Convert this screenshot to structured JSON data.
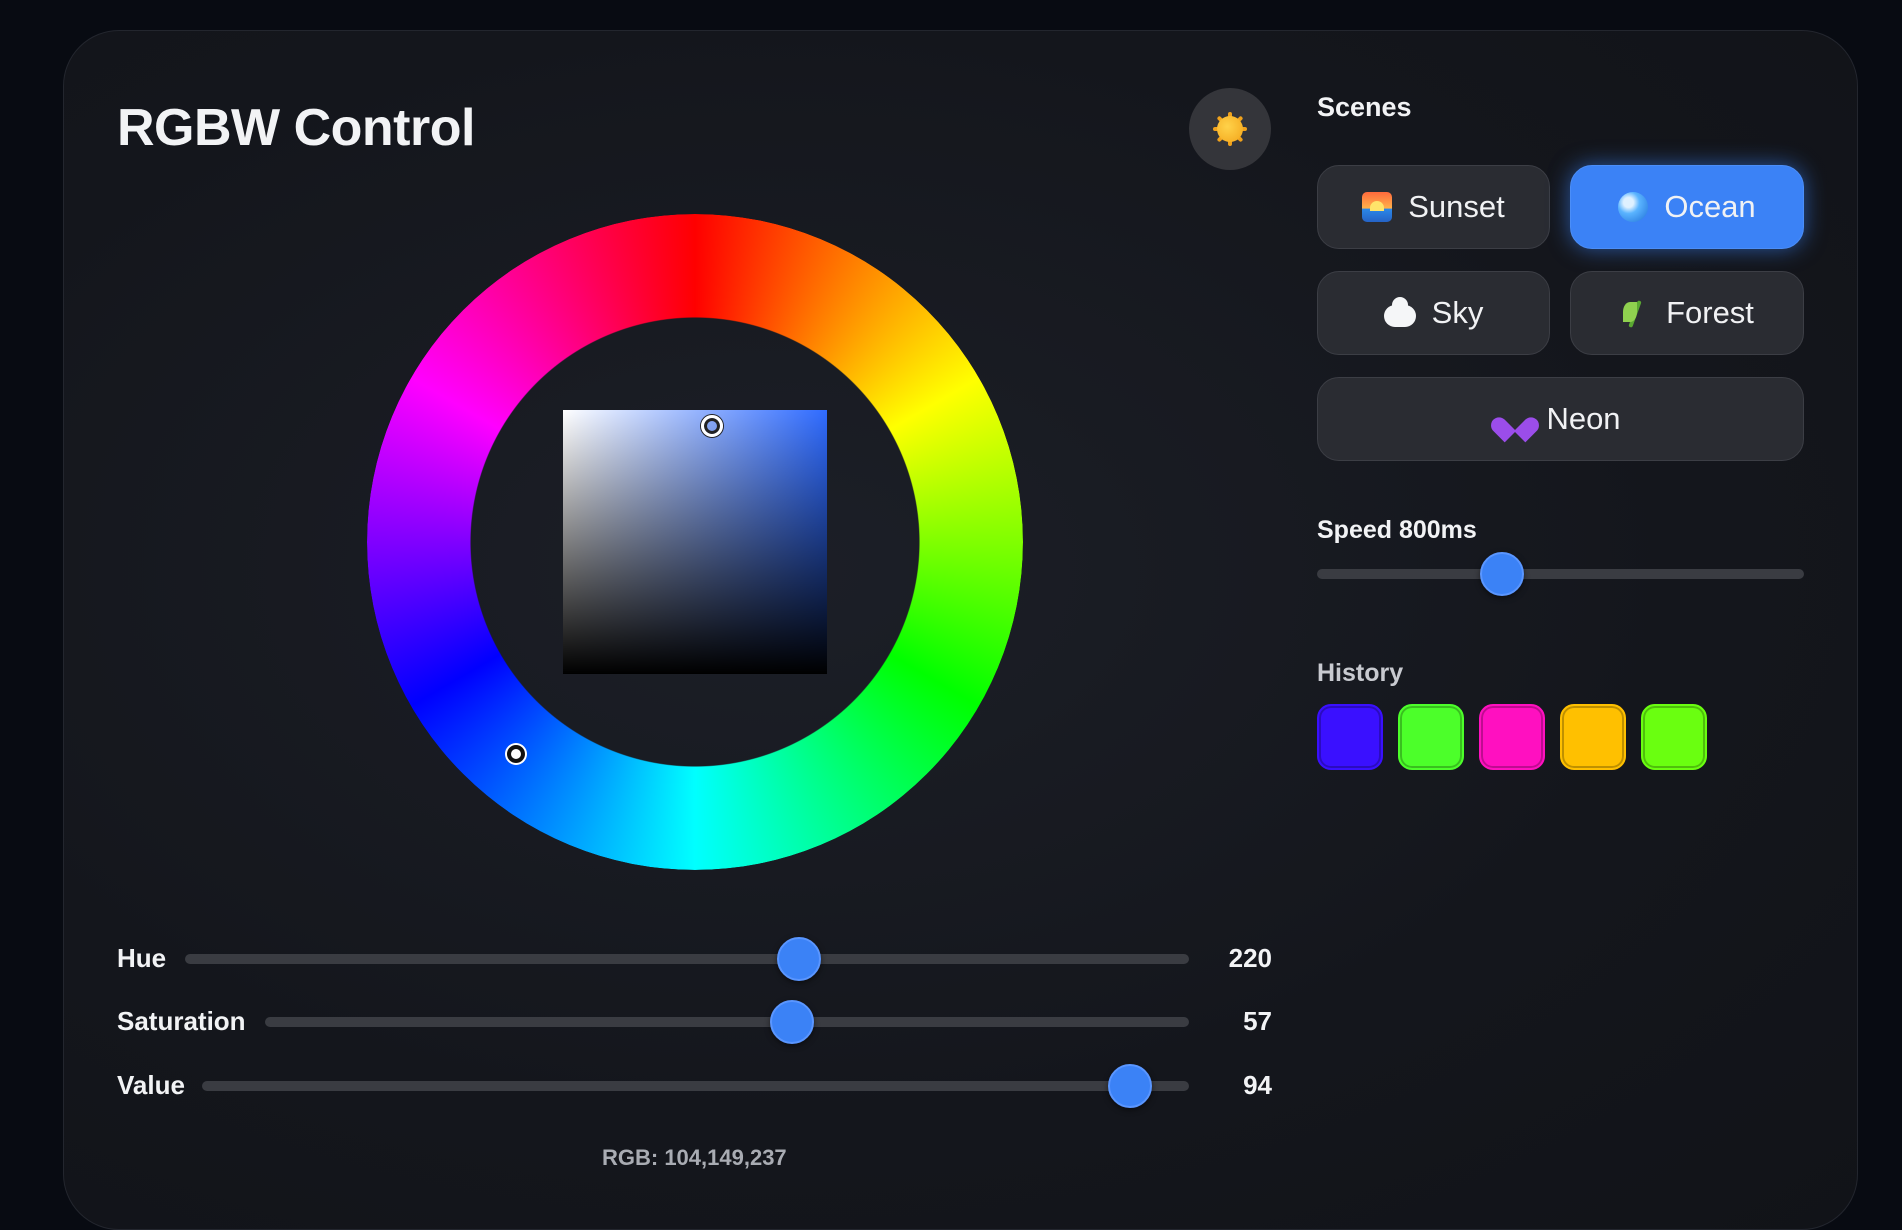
{
  "app": {
    "title": "RGBW Control",
    "theme_toggle_icon": "sun-icon"
  },
  "picker": {
    "wheel_icon": "color-wheel",
    "hue": 220,
    "saturation": 57,
    "value": 94
  },
  "sliders": [
    {
      "label": "Hue",
      "value": 220,
      "min": 0,
      "max": 360,
      "display": "220"
    },
    {
      "label": "Saturation",
      "value": 57,
      "min": 0,
      "max": 100,
      "display": "57"
    },
    {
      "label": "Value",
      "value": 94,
      "min": 0,
      "max": 100,
      "display": "94"
    }
  ],
  "readout": {
    "rgb": "RGB: 104,149,237"
  },
  "scenes": {
    "title": "Scenes",
    "items": [
      {
        "label": "Sunset",
        "icon": "sunset-icon",
        "active": false
      },
      {
        "label": "Ocean",
        "icon": "wave-icon",
        "active": true
      },
      {
        "label": "Sky",
        "icon": "cloud-icon",
        "active": false
      },
      {
        "label": "Forest",
        "icon": "herb-icon",
        "active": false
      },
      {
        "label": "Neon",
        "icon": "purple-heart-icon",
        "active": false
      }
    ]
  },
  "speed": {
    "label": "Speed 800ms",
    "value_ms": 800,
    "fraction": 0.38
  },
  "history": {
    "title": "History",
    "colors": [
      "#3a10ff",
      "#4cff2a",
      "#ff10c0",
      "#ffc000",
      "#6aff10"
    ]
  },
  "colors": {
    "accent": "#3b82f6",
    "background": "#14161c"
  }
}
